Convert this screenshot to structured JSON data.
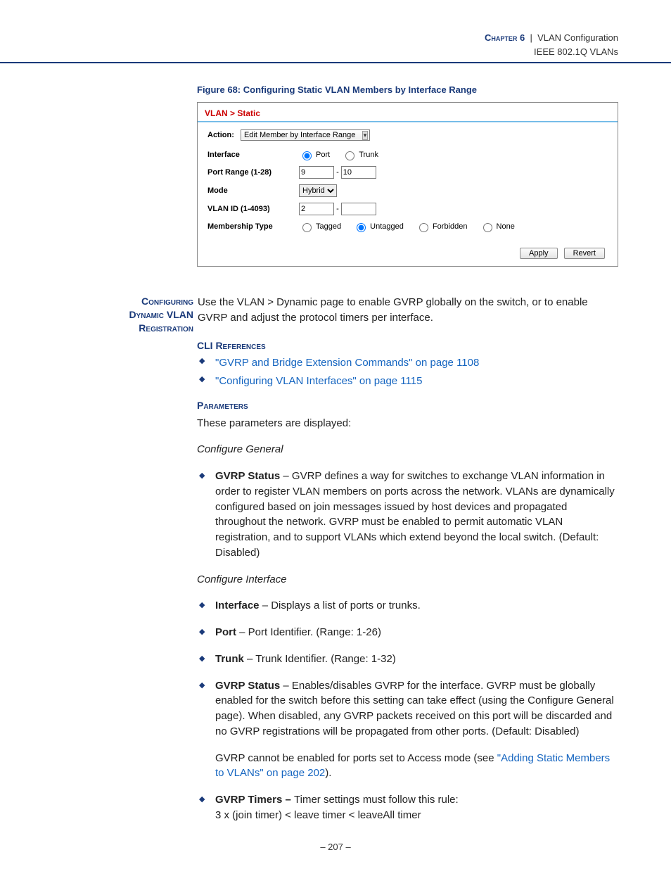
{
  "header": {
    "chapter": "Chapter 6",
    "sep": "|",
    "title": "VLAN Configuration",
    "subtitle": "IEEE 802.1Q VLANs"
  },
  "figure": {
    "caption": "Figure 68:  Configuring Static VLAN Members by Interface Range"
  },
  "panel": {
    "breadcrumb": "VLAN > Static",
    "action_label": "Action:",
    "action_value": "Edit Member by Interface Range",
    "rows": {
      "interface_label": "Interface",
      "iface_port": "Port",
      "iface_trunk": "Trunk",
      "port_range_label": "Port Range (1-28)",
      "port_range_from": "9",
      "port_range_sep": "-",
      "port_range_to": "10",
      "mode_label": "Mode",
      "mode_value": "Hybrid",
      "vlan_id_label": "VLAN ID (1-4093)",
      "vlan_id_from": "2",
      "vlan_id_sep": "-",
      "vlan_id_to": "",
      "mem_label": "Membership Type",
      "mem_tagged": "Tagged",
      "mem_untagged": "Untagged",
      "mem_forbidden": "Forbidden",
      "mem_none": "None"
    },
    "btn_apply": "Apply",
    "btn_revert": "Revert"
  },
  "doc": {
    "side_head_l1": "Configuring",
    "side_head_l2": "Dynamic VLAN",
    "side_head_l3": "Registration",
    "intro": "Use the VLAN > Dynamic page to enable GVRP globally on the switch, or to enable GVRP and adjust the protocol timers per interface.",
    "cli_head": "CLI References",
    "cli_link1": "\"GVRP and Bridge Extension Commands\" on page 1108",
    "cli_link2": "\"Configuring VLAN Interfaces\" on page 1115",
    "params_head": "Parameters",
    "params_intro": "These parameters are displayed:",
    "cg_head": "Configure General",
    "gvrp_status_term": "GVRP Status",
    "gvrp_status_text": " – GVRP defines a way for switches to exchange VLAN information in order to register VLAN members on ports across the network. VLANs are dynamically configured based on join messages issued by host devices and propagated throughout the network. GVRP must be enabled to permit automatic VLAN registration, and to support VLANs which extend beyond the local switch. (Default: Disabled)",
    "ci_head": "Configure Interface",
    "iface_term": "Interface",
    "iface_text": " – Displays a list of ports or trunks.",
    "port_term": "Port",
    "port_text": " – Port Identifier. (Range: 1-26)",
    "trunk_term": "Trunk",
    "trunk_text": " – Trunk Identifier. (Range: 1-32)",
    "gvrp2_term": "GVRP Status",
    "gvrp2_text": " – Enables/disables GVRP for the interface. GVRP must be globally enabled for the switch before this setting can take effect (using the Configure General page). When disabled, any GVRP packets received on this port will be discarded and no GVRP registrations will be propagated from other ports. (Default: Disabled)",
    "gvrp2_extra_pre": "GVRP cannot be enabled for ports set to Access mode (see ",
    "gvrp2_extra_link": "\"Adding Static Members to VLANs\" on page 202",
    "gvrp2_extra_post": ").",
    "timers_term": "GVRP Timers – ",
    "timers_text1": "Timer settings must follow this rule:",
    "timers_text2": "3 x (join timer) < leave timer < leaveAll timer"
  },
  "footer": {
    "page": "–  207  –"
  }
}
